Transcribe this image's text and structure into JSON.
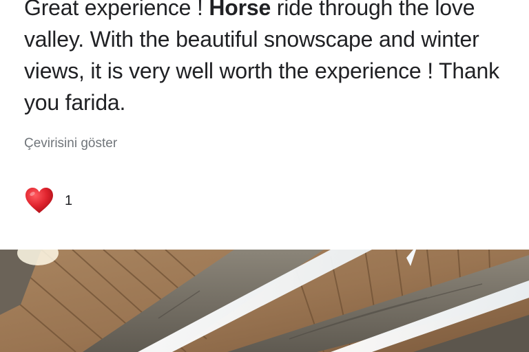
{
  "review": {
    "text_before": "Great experience ! ",
    "text_bold": "Horse",
    "text_after": " ride through the love valley. With the beautiful snowscape and winter views, it is very well worth the experience ! Thank you farida."
  },
  "translate_link": "Çevirisini göster",
  "reaction": {
    "icon": "red-heart-icon",
    "count": "1"
  },
  "colors": {
    "text": "#202124",
    "secondary": "#70757a",
    "heart": "#e0242e"
  }
}
